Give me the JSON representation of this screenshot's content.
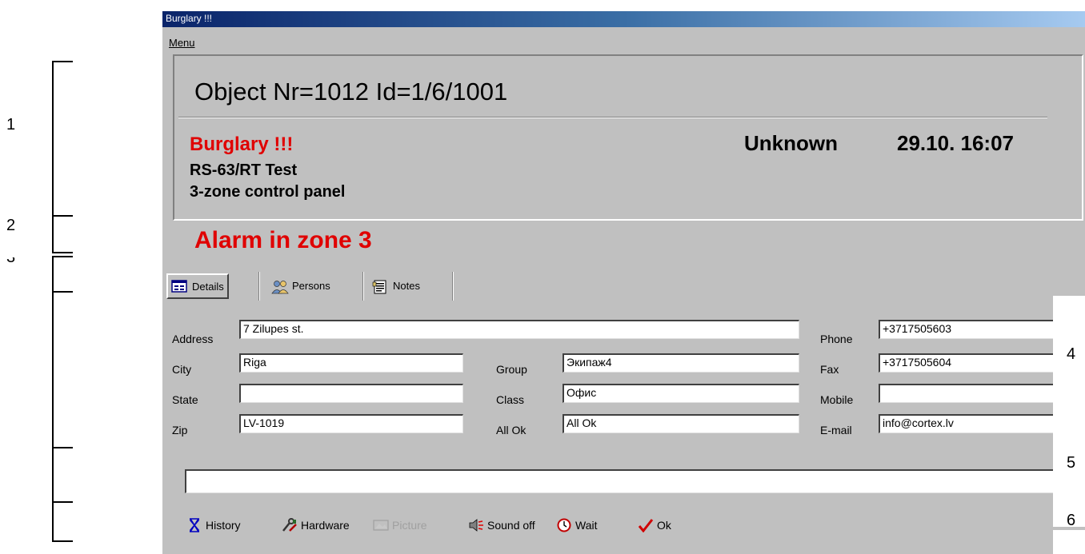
{
  "annotations": [
    "1",
    "2",
    "3",
    "4",
    "5",
    "6"
  ],
  "window": {
    "title": "Burglary !!!",
    "menu_label": "Menu"
  },
  "object": {
    "header": "Object Nr=1012   Id=1/6/1001",
    "event": "Burglary !!!",
    "status": "Unknown",
    "datetime": "29.10. 16:07",
    "line1": "RS-63/RT Test",
    "line2": "3-zone control panel",
    "alarm": "Alarm in zone 3"
  },
  "tabs": [
    {
      "label": "Details",
      "icon": "details-icon"
    },
    {
      "label": "Persons",
      "icon": "persons-icon"
    },
    {
      "label": "Notes",
      "icon": "notes-icon"
    }
  ],
  "fields": {
    "address": {
      "label": "Address",
      "value": "7 Zilupes st."
    },
    "city": {
      "label": "City",
      "value": "Riga"
    },
    "state": {
      "label": "State",
      "value": ""
    },
    "zip": {
      "label": "Zip",
      "value": "LV-1019"
    },
    "group": {
      "label": "Group",
      "value": "Экипаж4"
    },
    "class": {
      "label": "Class",
      "value": "Офис"
    },
    "allok": {
      "label": "All Ok",
      "value": "All Ok"
    },
    "phone": {
      "label": "Phone",
      "value": "+3717505603"
    },
    "fax": {
      "label": "Fax",
      "value": "+3717505604"
    },
    "mobile": {
      "label": "Mobile",
      "value": ""
    },
    "email": {
      "label": "E-mail",
      "value": "info@cortex.lv"
    }
  },
  "toolbar": {
    "history": "History",
    "hardware": "Hardware",
    "picture": "Picture",
    "sound_off": "Sound off",
    "wait": "Wait",
    "ok": "Ok"
  },
  "colors": {
    "alarm_red": "#e00000",
    "window_bg": "#c0c0c0",
    "titlebar": "#0a246a"
  }
}
